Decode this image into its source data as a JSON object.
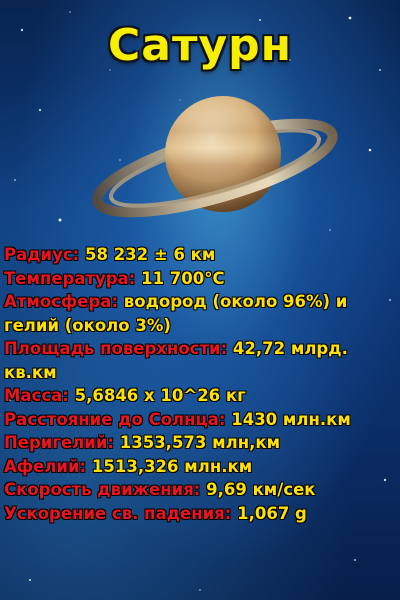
{
  "title": "Сатурн",
  "colors": {
    "title": "#f6f000",
    "label": "#e8141e",
    "value": "#ffe000",
    "background": "#0d3a7a"
  },
  "facts": [
    {
      "label": "Радиус:",
      "value": "58 232 ± 6 км"
    },
    {
      "label": "Температура:",
      "value": "11 700°C"
    },
    {
      "label": "Атмосфера:",
      "value": "водород (около 96%) и гелий (около 3%)"
    },
    {
      "label": "Площадь поверхности:",
      "value": "42,72 млрд. кв.км"
    },
    {
      "label": "Масса:",
      "value": "5,6846 x 10^26 кг"
    },
    {
      "label": "Расстояние до Солнца:",
      "value": "1430 млн.км"
    },
    {
      "label": "Перигелий:",
      "value": "1353,573 млн,км"
    },
    {
      "label": "Афелий:",
      "value": "1513,326 млн.км"
    },
    {
      "label": "Скорость движения:",
      "value": "9,69 км/сек"
    },
    {
      "label": "Ускорение св. падения:",
      "value": "1,067 g"
    }
  ]
}
